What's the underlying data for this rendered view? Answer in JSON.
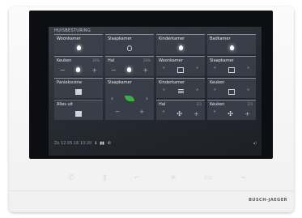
{
  "screen_title": "HUISBESTURING",
  "tiles": [
    {
      "name": "Woonkamer",
      "icon": "bulb-on"
    },
    {
      "name": "Slaapkamer",
      "icon": "bulb-off"
    },
    {
      "name": "Kinderkamer",
      "icon": "bulb-on"
    },
    {
      "name": "Badkamer",
      "icon": "bulb-on"
    },
    {
      "name": "Keuken",
      "value": "30%",
      "icon": "dimmer"
    },
    {
      "name": "Hal",
      "value": "20%",
      "icon": "dimmer"
    },
    {
      "name": "Woonkamer",
      "icon": "blinds"
    },
    {
      "name": "Slaapkamer",
      "icon": "blinds"
    },
    {
      "name": "Paniekscène",
      "icon": "scene"
    },
    {
      "name": "Slaapkamer",
      "icon": "leaf-climate"
    },
    {
      "name": "Kinderkamer",
      "icon": "blinds"
    },
    {
      "name": "Keuken",
      "icon": "blinds"
    },
    {
      "name": "Alles uit",
      "icon": "scene"
    },
    {
      "name": "Hal",
      "value": "2/3",
      "icon": "fan"
    },
    {
      "name": "Keuken",
      "value": "2/3",
      "icon": "fan"
    }
  ],
  "status": {
    "datetime": "Zo 12.05.16  10:20"
  },
  "hardware_buttons": [
    "phone-icon",
    "key-icon",
    "light-switch-icon",
    "sun-icon",
    "screen-icon",
    "mic-icon"
  ],
  "brand": "BUSCH-JAEGER"
}
